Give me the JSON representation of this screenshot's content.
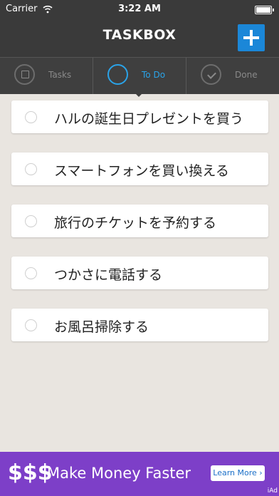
{
  "status_bar": {
    "carrier": "Carrier",
    "time": "3:22 AM"
  },
  "header": {
    "title": "TASKBOX",
    "accent_color": "#1b87d8"
  },
  "tabs": [
    {
      "label": "Tasks",
      "icon": "calendar-check-icon",
      "active": false
    },
    {
      "label": "To Do",
      "icon": "circle-icon",
      "active": true
    },
    {
      "label": "Done",
      "icon": "check-circle-icon",
      "active": false
    }
  ],
  "tasks": [
    {
      "text": "ハルの誕生日プレゼントを買う"
    },
    {
      "text": "スマートフォンを買い換える"
    },
    {
      "text": "旅行のチケットを予約する"
    },
    {
      "text": "つかさに電話する"
    },
    {
      "text": "お風呂掃除する"
    }
  ],
  "ad": {
    "symbol": "$$$",
    "title": "Make Money Faster",
    "button": "Learn More",
    "badge": "iAd",
    "background": "#7d3fc8"
  }
}
